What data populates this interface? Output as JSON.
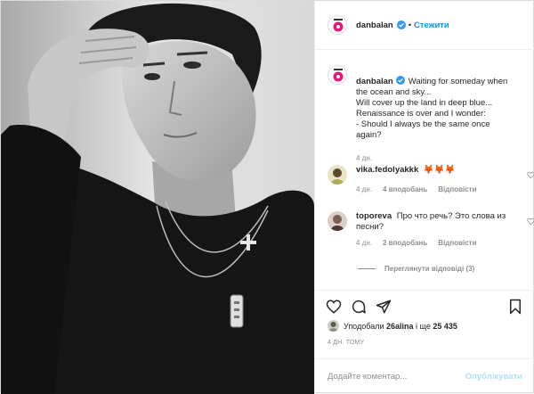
{
  "header": {
    "username": "danbalan",
    "dot": "•",
    "follow_label": "Стежити"
  },
  "caption": {
    "username": "danbalan",
    "text": "Waiting for someday when the ocean and sky...\nWill cover up the land in deep blue...\nRenaissance is over and I wonder:\n- Should I always be the same once again?",
    "age": "4 дн."
  },
  "comments": [
    {
      "username": "vika.fedolyakkk",
      "text": "🦊🦊🦊",
      "age": "4 дн.",
      "likes": "4 вподобань",
      "reply_label": "Відповісти"
    },
    {
      "username": "toporeva",
      "text": "Про что речь? Это слова из песни?",
      "age": "4 дн.",
      "likes": "2 вподобань",
      "reply_label": "Відповісти",
      "view_replies": "Переглянути відповіді (3)"
    }
  ],
  "likes_line": {
    "prefix": "Уподобали",
    "user": "26alina",
    "middle": "і ще",
    "count": "25 435"
  },
  "timestamp": "4 ДН. ТОМУ",
  "add_comment": {
    "placeholder": "Додайте коментар...",
    "publish_label": "Опублікувати"
  },
  "colors": {
    "accent": "#0095f6",
    "publish_disabled": "#b2dffc",
    "secondary_text": "#8e8e8e",
    "logo_pink": "#e8167f"
  },
  "icons": [
    "verified-icon",
    "heart-icon",
    "comment-icon",
    "share-icon",
    "bookmark-icon"
  ]
}
